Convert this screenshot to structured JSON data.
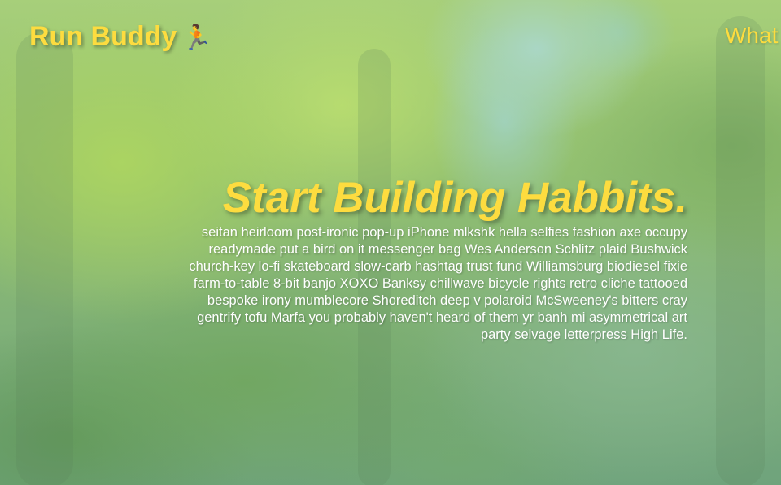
{
  "header": {
    "logo_text": "Run Buddy",
    "logo_icon": "🏃",
    "nav": [
      {
        "label": "What"
      }
    ]
  },
  "hero": {
    "title": "Start Building Habbits.",
    "body": "seitan heirloom post-ironic pop-up iPhone mlkshk hella selfies fashion axe occupy readymade put a bird on it messenger bag Wes Anderson Schlitz plaid Bushwick church-key lo-fi skateboard slow-carb hashtag trust fund Williamsburg biodiesel fixie farm-to-table 8-bit banjo XOXO Banksy chillwave bicycle rights retro cliche tattooed bespoke irony mumblecore Shoreditch deep v polaroid McSweeney's bitters cray gentrify tofu Marfa you probably haven't heard of them yr banh mi asymmetrical art party selvage letterpress High Life."
  },
  "colors": {
    "accent": "#fddc3f",
    "text": "#ffffff"
  }
}
